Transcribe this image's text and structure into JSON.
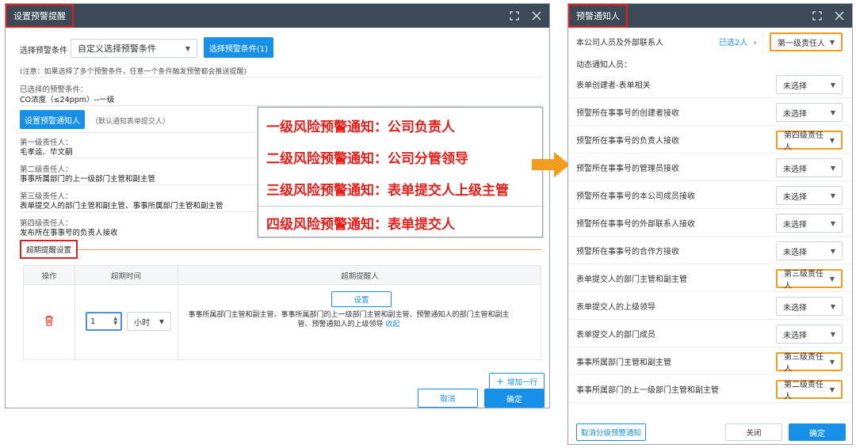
{
  "left": {
    "title": "设置预警提醒",
    "select_label": "选择预警条件",
    "select_value": "自定义选择预警条件",
    "select_button": "选择预警条件(1)",
    "note": "(注意：如果选择了多个预警条件，任意一个条件触发预警都会推送提醒)",
    "selected_label": "已选择的预警条件：",
    "selected_value": "CO浓度（≤24ppm）--一级",
    "set_notify_button": "设置预警通知人",
    "default_notify": "（默认通知表单提交人）",
    "levels": [
      {
        "label": "第一级责任人：",
        "value": "毛孝逵、毕文嗣"
      },
      {
        "label": "第二级责任人：",
        "value": "事事所属部门的上一级部门主管和副主管"
      },
      {
        "label": "第三级责任人：",
        "value": "表单提交人的部门主管和副主管、事事所属部门主管和副主管"
      },
      {
        "label": "第四级责任人：",
        "value": "发布所在事事号的负责人接收"
      }
    ],
    "overlay": [
      "一级风险预警通知：公司负责人",
      "二级风险预警通知：公司分管领导",
      "三级风险预警通知：表单提交人上级主管",
      "四级风险预警通知：表单提交人"
    ],
    "overdue_title": "超期提醒设置",
    "table": {
      "headers": [
        "操作",
        "超期时间",
        "超期提醒人"
      ],
      "time_value": "1",
      "time_unit": "小时",
      "set_button": "设置",
      "reminders": "事事所属部门主管和副主管、事事所属部门的上一级部门主管和副主管、预警通知人的部门主管和副主管、预警通知人的上级领导",
      "collapse": "收起"
    },
    "add_row": "增加一行",
    "cancel": "取消",
    "confirm": "确定"
  },
  "right": {
    "title": "预警通知人",
    "top_row": {
      "label": "本公司人员及外部联系人",
      "selected": "已选2人",
      "value": "第一级责任人"
    },
    "dynamic_label": "动态通知人员：",
    "rows": [
      {
        "label": "表单创建者-表单相关",
        "value": "未选择",
        "highlight": false
      },
      {
        "label": "预警所在事事号的创建者接收",
        "value": "未选择",
        "highlight": false
      },
      {
        "label": "预警所在事事号的负责人接收",
        "value": "第四级责任人",
        "highlight": true
      },
      {
        "label": "预警所在事事号的管理员接收",
        "value": "未选择",
        "highlight": false
      },
      {
        "label": "预警所在事事号的本公司成员接收",
        "value": "未选择",
        "highlight": false
      },
      {
        "label": "预警所在事事号的外部联系人接收",
        "value": "未选择",
        "highlight": false
      },
      {
        "label": "预警所在事事号的合作方接收",
        "value": "未选择",
        "highlight": false
      },
      {
        "label": "表单提交人的部门主管和副主管",
        "value": "第三级责任人",
        "highlight": true
      },
      {
        "label": "表单提交人的上级领导",
        "value": "未选择",
        "highlight": false
      },
      {
        "label": "表单提交人的部门成员",
        "value": "未选择",
        "highlight": false
      },
      {
        "label": "事事所属部门主管和副主管",
        "value": "第三级责任人",
        "highlight": true
      },
      {
        "label": "事事所属部门的上一级部门主管和副主管",
        "value": "第二级责任人",
        "highlight": true
      }
    ],
    "cancel_level": "取消分级预警通知",
    "close": "关闭",
    "confirm": "确定"
  },
  "colors": {
    "accent": "#1890e8",
    "title_bg": "#3c4a57",
    "red": "#e3211c",
    "orange": "#f39c1e"
  }
}
